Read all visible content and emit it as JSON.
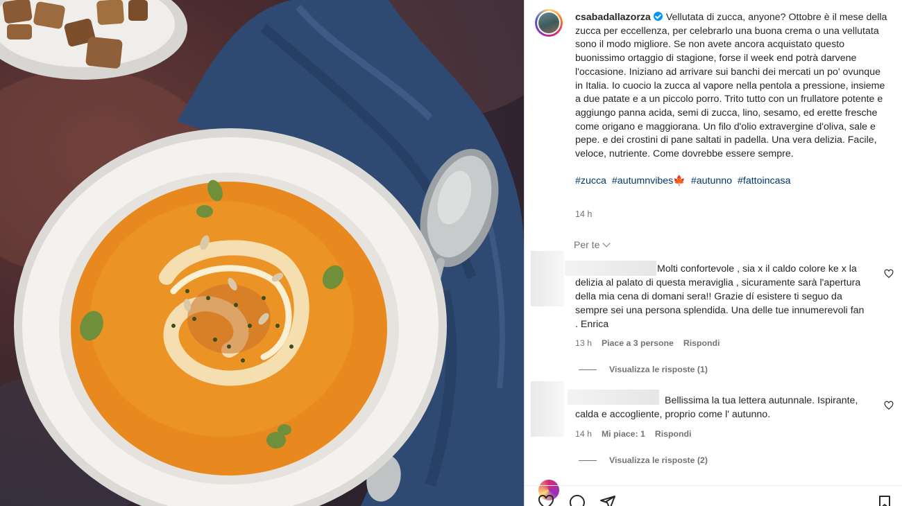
{
  "post": {
    "username": "csabadallazorza",
    "caption": "Vellutata di zucca, anyone? Ottobre è il mese della zucca per eccellenza, per celebrarlo una buona crema o una vellutata sono il modo migliore. Se non avete ancora acquistato questo buonissimo ortaggio di stagione, forse il week end potrà darvene l'occasione. Iniziano ad arrivare sui banchi dei mercati un po' ovunque in Italia. Io cuocio la zucca al vapore nella pentola a pressione, insieme a due patate e a un piccolo porro. Trito tutto con un frullatore potente e aggiungo panna acida, semi di zucca, lino, sesamo, ed erette fresche come origano e maggiorana. Un filo d'olio extravergine d'oliva, sale e pepe. e dei crostini di pane saltati in padella. Una vera delizia. Facile, veloce, nutriente. Come dovrebbe essere sempre.",
    "hashtags": [
      "#zucca",
      "#autumnvibes🍁",
      "#autunno",
      "#fattoincasa"
    ],
    "time": "14 h"
  },
  "comments_header": {
    "sort_label": "Per te"
  },
  "comments": [
    {
      "text": "Molti confortevole , sia x il caldo colore ke x la delizia al palato di questa meraviglia , sicuramente sarà l'apertura della mia cena di domani sera!! Grazie dí esistere ti seguo da sempre sei una persona splendida. Una delle tue innumerevoli fan . Enrica",
      "time": "13 h",
      "likes": "Piace a 3 persone",
      "reply": "Rispondi",
      "view_replies": "Visualizza le risposte (1)"
    },
    {
      "text": "Bellissima la tua lettera autunnale. Ispirante, calda e accogliente, proprio come l' autunno.",
      "time": "14 h",
      "likes": "Mi piace: 1",
      "reply": "Rispondi",
      "view_replies": "Visualizza le risposte (2)"
    }
  ],
  "icons": [
    "verified-badge-icon",
    "chevron-down-icon",
    "heart-icon",
    "comment-icon",
    "share-icon",
    "bookmark-icon"
  ],
  "colors": {
    "link": "#00376b",
    "muted": "#737373",
    "verified": "#0095f6",
    "soup": "#e8891f"
  }
}
